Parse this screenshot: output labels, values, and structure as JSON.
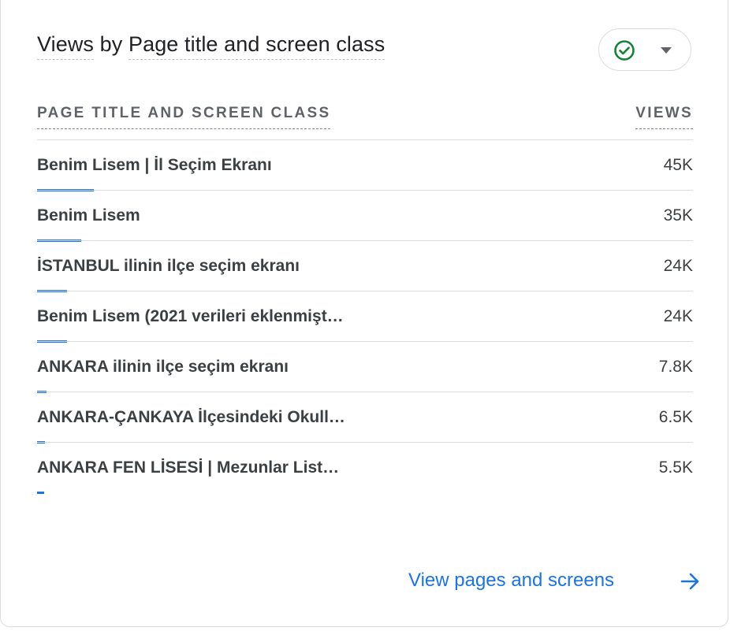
{
  "card": {
    "title_part1": "Views",
    "title_by": " by ",
    "title_part2": "Page title and screen class",
    "status_icon": "check-circle-icon",
    "dropdown_icon": "caret-down-icon",
    "accent_color": "#1a73e8",
    "status_color": "#188038"
  },
  "table": {
    "col_title": "PAGE TITLE AND SCREEN CLASS",
    "col_views": "VIEWS",
    "rows": [
      {
        "label": "Benim Lisem | İl Seçim Ekranı",
        "value": "45K",
        "views": 45000
      },
      {
        "label": "Benim Lisem",
        "value": "35K",
        "views": 35000
      },
      {
        "label": "İSTANBUL ilinin ilçe seçim ekranı",
        "value": "24K",
        "views": 24000
      },
      {
        "label": "Benim Lisem (2021 verileri eklenmişt…",
        "value": "24K",
        "views": 24000
      },
      {
        "label": "ANKARA ilinin ilçe seçim ekranı",
        "value": "7.8K",
        "views": 7800
      },
      {
        "label": "ANKARA-ÇANKAYA İlçesindeki Okull…",
        "value": "6.5K",
        "views": 6500
      },
      {
        "label": "ANKARA FEN LİSESİ | Mezunlar List…",
        "value": "5.5K",
        "views": 5500
      }
    ]
  },
  "footer": {
    "link_label": "View pages and screens",
    "link_icon": "arrow-right-icon"
  }
}
